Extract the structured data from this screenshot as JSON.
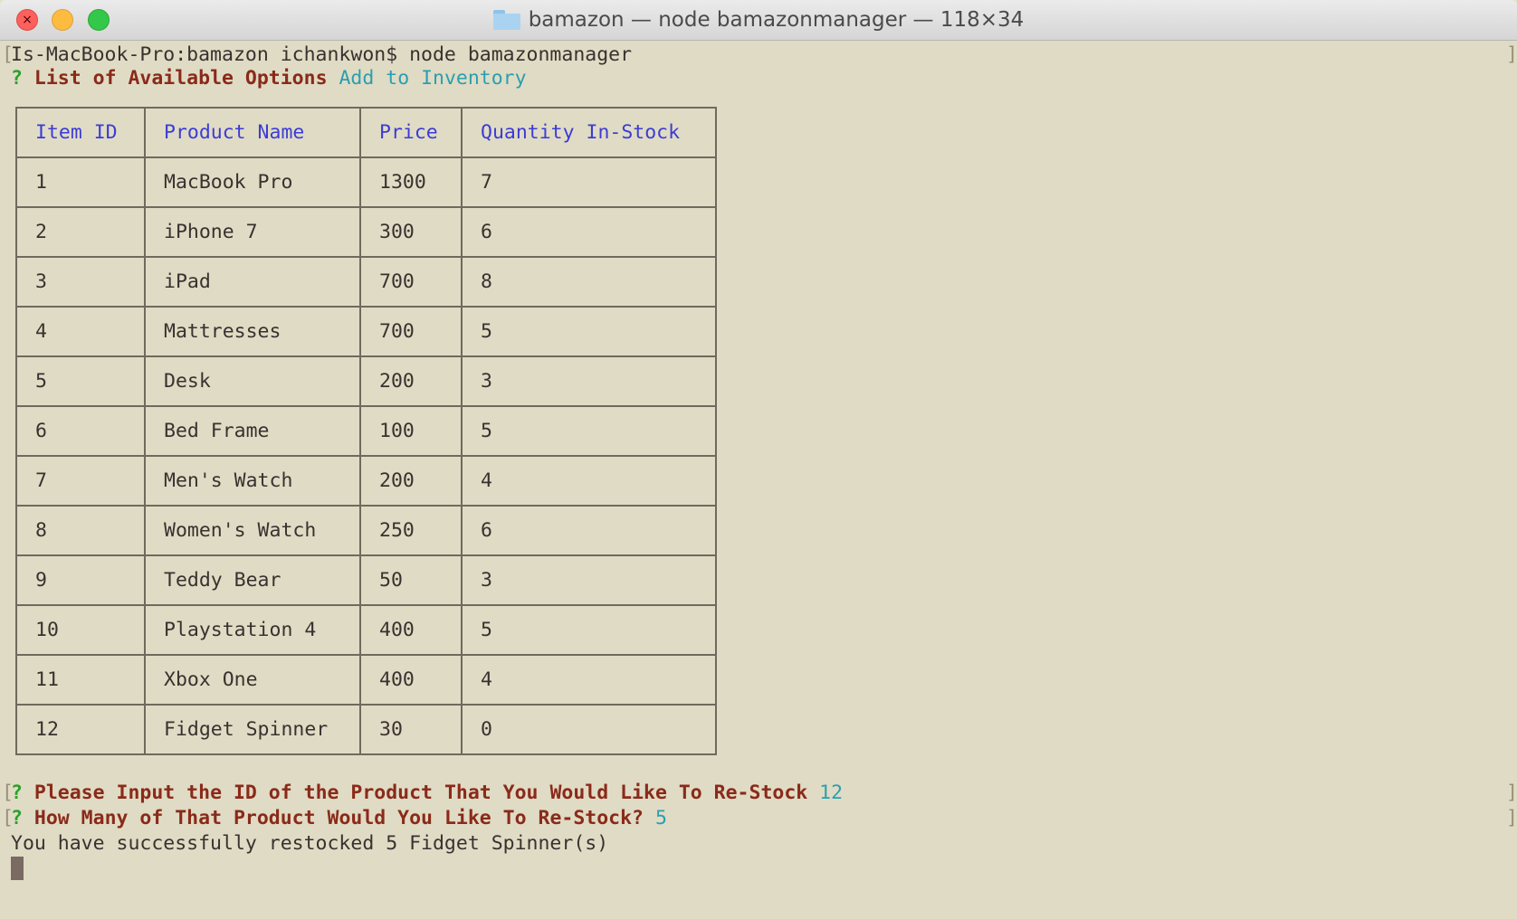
{
  "window": {
    "title": "bamazon — node bamazonmanager — 118×34",
    "folder_icon": "folder-icon",
    "controls": [
      "close",
      "minimize",
      "zoom"
    ]
  },
  "terminal": {
    "prompt_line": "Is-MacBook-Pro:bamazon ichankwon$ node bamazonmanager",
    "menu": {
      "question_mark": "?",
      "label": "List of Available Options",
      "selected": "Add to Inventory"
    },
    "table": {
      "headers": [
        "Item ID",
        "Product Name",
        "Price",
        "Quantity In-Stock"
      ],
      "rows": [
        [
          "1",
          "MacBook Pro",
          "1300",
          "7"
        ],
        [
          "2",
          "iPhone 7",
          "300",
          "6"
        ],
        [
          "3",
          "iPad",
          "700",
          "8"
        ],
        [
          "4",
          "Mattresses",
          "700",
          "5"
        ],
        [
          "5",
          "Desk",
          "200",
          "3"
        ],
        [
          "6",
          "Bed Frame",
          "100",
          "5"
        ],
        [
          "7",
          "Men's Watch",
          "200",
          "4"
        ],
        [
          "8",
          "Women's Watch",
          "250",
          "6"
        ],
        [
          "9",
          "Teddy Bear",
          "50",
          "3"
        ],
        [
          "10",
          "Playstation 4",
          "400",
          "5"
        ],
        [
          "11",
          "Xbox One",
          "400",
          "4"
        ],
        [
          "12",
          "Fidget Spinner",
          "30",
          "0"
        ]
      ]
    },
    "prompt_id": {
      "question_mark": "?",
      "label": "Please Input the ID of the Product That You Would Like To Re-Stock",
      "answer": "12"
    },
    "prompt_qty": {
      "question_mark": "?",
      "label": "How Many of That Product Would You Like To Re-Stock?",
      "answer": "5"
    },
    "result": "You have successfully restocked 5 Fidget Spinner(s)",
    "colors": {
      "background": "#e0dbc4",
      "question_mark": "#2aa12a",
      "prompt_text": "#8a2a1a",
      "answer": "#2a9fb0",
      "table_header": "#3b3cd6",
      "plain_text": "#3b3030"
    }
  }
}
